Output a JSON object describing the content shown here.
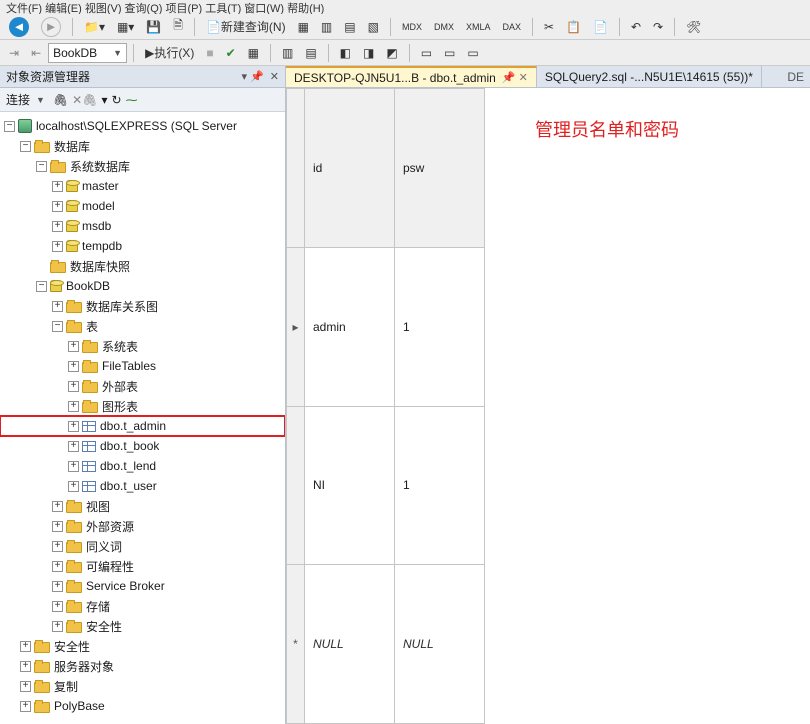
{
  "menubar_hint": "文件(F)  编辑(E)  视图(V)  查询(Q)  项目(P)  工具(T)  窗口(W)  帮助(H)",
  "toolbar1": {
    "new_query": "新建查询(N)"
  },
  "toolbar2": {
    "database_combo": "BookDB",
    "execute": "执行(X)"
  },
  "sidebar": {
    "title": "对象资源管理器",
    "connect_label": "连接",
    "server": "localhost\\SQLEXPRESS (SQL Server",
    "nodes": {
      "databases": "数据库",
      "system_databases": "系统数据库",
      "master": "master",
      "model": "model",
      "msdb": "msdb",
      "tempdb": "tempdb",
      "db_snapshots": "数据库快照",
      "bookdb": "BookDB",
      "db_diagrams": "数据库关系图",
      "tables": "表",
      "system_tables": "系统表",
      "filetables": "FileTables",
      "external_tables": "外部表",
      "graph_tables": "图形表",
      "t_admin": "dbo.t_admin",
      "t_book": "dbo.t_book",
      "t_lend": "dbo.t_lend",
      "t_user": "dbo.t_user",
      "views": "视图",
      "external_resources": "外部资源",
      "synonyms": "同义词",
      "programmability": "可编程性",
      "service_broker": "Service Broker",
      "storage": "存储",
      "security_db": "安全性",
      "security": "安全性",
      "server_objects": "服务器对象",
      "replication": "复制",
      "polybase": "PolyBase"
    }
  },
  "tabs": {
    "tab_admin": "DESKTOP-QJN5U1...B - dbo.t_admin",
    "tab_query": "SQLQuery2.sql -...N5U1E\\14615 (55))*",
    "tab_end": "DE"
  },
  "grid": {
    "columns": [
      "id",
      "psw"
    ],
    "rows": [
      {
        "id": "admin",
        "psw": "1"
      },
      {
        "id": "NI",
        "psw": "1"
      }
    ],
    "null_text": "NULL"
  },
  "annotation": "管理员名单和密码"
}
